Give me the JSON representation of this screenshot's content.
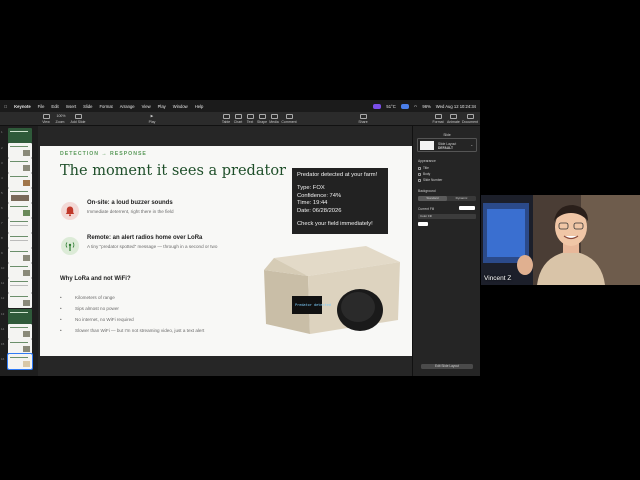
{
  "menubar": {
    "app": "Keynote",
    "items": [
      "File",
      "Edit",
      "Insert",
      "Slide",
      "Format",
      "Arrange",
      "View",
      "Play",
      "Window",
      "Help"
    ],
    "weather": "51°C",
    "battery": "96%",
    "datetime": "Wed Aug 12  10:24:34"
  },
  "toolbar": {
    "buttons": [
      {
        "label": "View"
      },
      {
        "label": "Zoom"
      },
      {
        "label": "Add Slide"
      },
      {
        "label": "Play"
      },
      {
        "label": "Table"
      },
      {
        "label": "Chart"
      },
      {
        "label": "Text"
      },
      {
        "label": "Shape"
      },
      {
        "label": "Media"
      },
      {
        "label": "Comment"
      },
      {
        "label": "Share"
      },
      {
        "label": "Format"
      },
      {
        "label": "Animate"
      },
      {
        "label": "Document"
      }
    ],
    "zoom_value": "100%"
  },
  "navigator": {
    "slide_numbers": [
      "1",
      "2",
      "3",
      "4",
      "5",
      "6",
      "7",
      "8",
      "9",
      "10",
      "11",
      "12",
      "13",
      "14",
      "15",
      "16"
    ]
  },
  "slide": {
    "kicker": "DETECTION → RESPONSE",
    "title": "The moment it sees a predator",
    "onsite_title": "On-site: a loud buzzer sounds",
    "onsite_sub": "Immediate deterrent, right there in the field",
    "remote_title": "Remote: an alert radios home over LoRa",
    "remote_sub": "A tiny \"predator spotted\" message — through in a second or two",
    "why_title": "Why LoRa and not WiFi?",
    "bullets": [
      "Kilometers of range",
      "Sips almost no power",
      "No internet, no WiFi required",
      "Slower than WiFi — but I'm not streaming video, just a text alert"
    ],
    "alert": {
      "headline": "Predator detected at your farm!",
      "type": "Type: FOX",
      "confidence": "Confidence: 74%",
      "time": "Time: 19:44",
      "date": "Date: 06/28/2026",
      "footer": "Check your field immediately!"
    },
    "device_screen_text": "Predator detected"
  },
  "inspector": {
    "header": "Slide",
    "layout_name": "Slide Layout",
    "layout_value": "DEFAULT",
    "appearance_label": "Appearance",
    "checkboxes": [
      "Title",
      "Body",
      "Slide Number"
    ],
    "background_label": "Background",
    "seg_standard": "Standard",
    "seg_dynamic": "Dynamic",
    "fill_label": "Current Fill",
    "fill_value": "Color Fill",
    "edit_button": "Edit Slide Layout"
  },
  "webcam": {
    "name": "Vincent Z"
  },
  "colors": {
    "accent_green": "#1f4f2a",
    "selection_blue": "#2f7bf6",
    "alert_bg": "#222222"
  }
}
